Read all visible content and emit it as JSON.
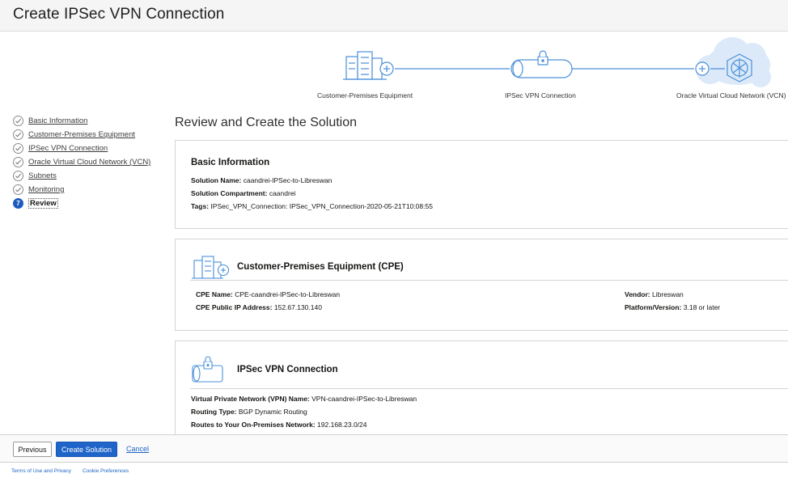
{
  "header": {
    "title": "Create IPSec VPN Connection"
  },
  "diagram": {
    "nodes": [
      {
        "label": "Customer-Premises Equipment",
        "icon": "server-rack-icon"
      },
      {
        "label": "IPSec VPN Connection",
        "icon": "vpn-tunnel-icon"
      },
      {
        "label": "Oracle Virtual Cloud Network (VCN)",
        "icon": "cloud-network-icon"
      }
    ]
  },
  "steps": [
    {
      "label": "Basic Information",
      "state": "complete"
    },
    {
      "label": "Customer-Premises Equipment",
      "state": "complete"
    },
    {
      "label": "IPSec VPN Connection",
      "state": "complete"
    },
    {
      "label": "Oracle Virtual Cloud Network (VCN)",
      "state": "complete"
    },
    {
      "label": "Subnets",
      "state": "complete"
    },
    {
      "label": "Monitoring",
      "state": "complete"
    },
    {
      "label": "Review",
      "state": "active",
      "marker": "7"
    }
  ],
  "main": {
    "title": "Review and Create the Solution",
    "basic": {
      "heading": "Basic Information",
      "fields": [
        {
          "label": "Solution Name:",
          "value": "caandrei-IPSec-to-Libreswan"
        },
        {
          "label": "Solution Compartment:",
          "value": "caandrei"
        },
        {
          "label": "Tags:",
          "value": "IPSec_VPN_Connection: IPSec_VPN_Connection-2020-05-21T10:08:55"
        }
      ]
    },
    "cpe": {
      "heading": "Customer-Premises Equipment (CPE)",
      "left": [
        {
          "label": "CPE Name:",
          "value": "CPE-caandrei-IPSec-to-Libreswan"
        },
        {
          "label": "CPE Public IP Address:",
          "value": "152.67.130.140"
        }
      ],
      "right": [
        {
          "label": "Vendor:",
          "value": "Libreswan"
        },
        {
          "label": "Platform/Version:",
          "value": "3.18 or later"
        }
      ]
    },
    "vpn": {
      "heading": "IPSec VPN Connection",
      "fields": [
        {
          "label": "Virtual Private Network (VPN) Name:",
          "value": "VPN-caandrei-IPSec-to-Libreswan"
        },
        {
          "label": "Routing Type:",
          "value": "BGP Dynamic Routing"
        },
        {
          "label": "Routes to Your On-Premises Network:",
          "value": "192.168.23.0/24"
        }
      ]
    }
  },
  "footer": {
    "previous": "Previous",
    "create": "Create Solution",
    "cancel": "Cancel"
  },
  "legal": {
    "terms": "Terms of Use and Privacy",
    "cookies": "Cookie Preferences"
  },
  "colors": {
    "accent": "#1f64c8",
    "diagram_line": "#4a90d9",
    "cloud": "#dbe9f8"
  }
}
